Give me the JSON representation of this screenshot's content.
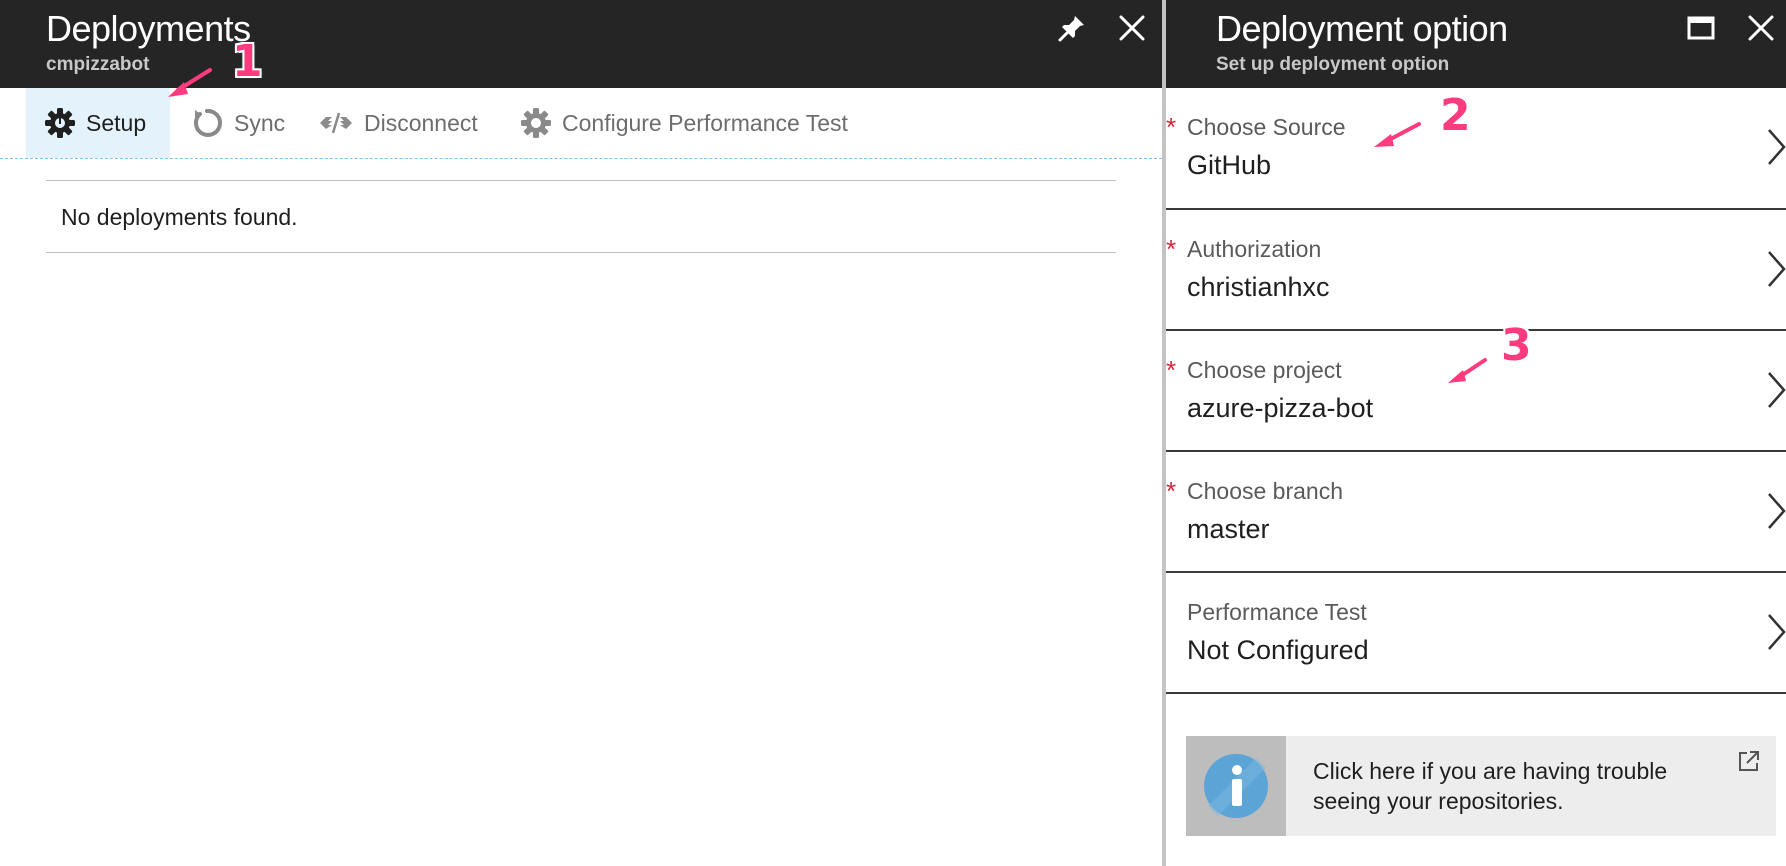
{
  "left_blade": {
    "title": "Deployments",
    "subtitle": "cmpizzabot",
    "toolbar": {
      "setup": "Setup",
      "sync": "Sync",
      "disconnect": "Disconnect",
      "perf_test": "Configure Performance Test"
    },
    "empty_message": "No deployments found."
  },
  "right_blade": {
    "title": "Deployment option",
    "subtitle": "Set up deployment option",
    "options": [
      {
        "label": "Choose Source",
        "value": "GitHub",
        "required": true
      },
      {
        "label": "Authorization",
        "value": "christianhxc",
        "required": true
      },
      {
        "label": "Choose project",
        "value": "azure-pizza-bot",
        "required": true
      },
      {
        "label": "Choose branch",
        "value": "master",
        "required": true
      },
      {
        "label": "Performance Test",
        "value": "Not Configured",
        "required": false
      }
    ],
    "required_mark": "*",
    "info_message": "Click here if you are having trouble seeing your repositories."
  },
  "annotations": [
    "1",
    "2",
    "3"
  ],
  "icons": [
    "pin-icon",
    "close-icon",
    "gear-icon",
    "sync-icon",
    "disconnect-icon",
    "maximize-icon",
    "chevron-right-icon",
    "info-icon",
    "external-link-icon"
  ],
  "colors": {
    "header_bg": "#252525",
    "active_tab_bg": "#e4f3fb",
    "required": "#d1283a",
    "annotation": "#ff3b7f",
    "info_icon": "#5aa4d6"
  }
}
